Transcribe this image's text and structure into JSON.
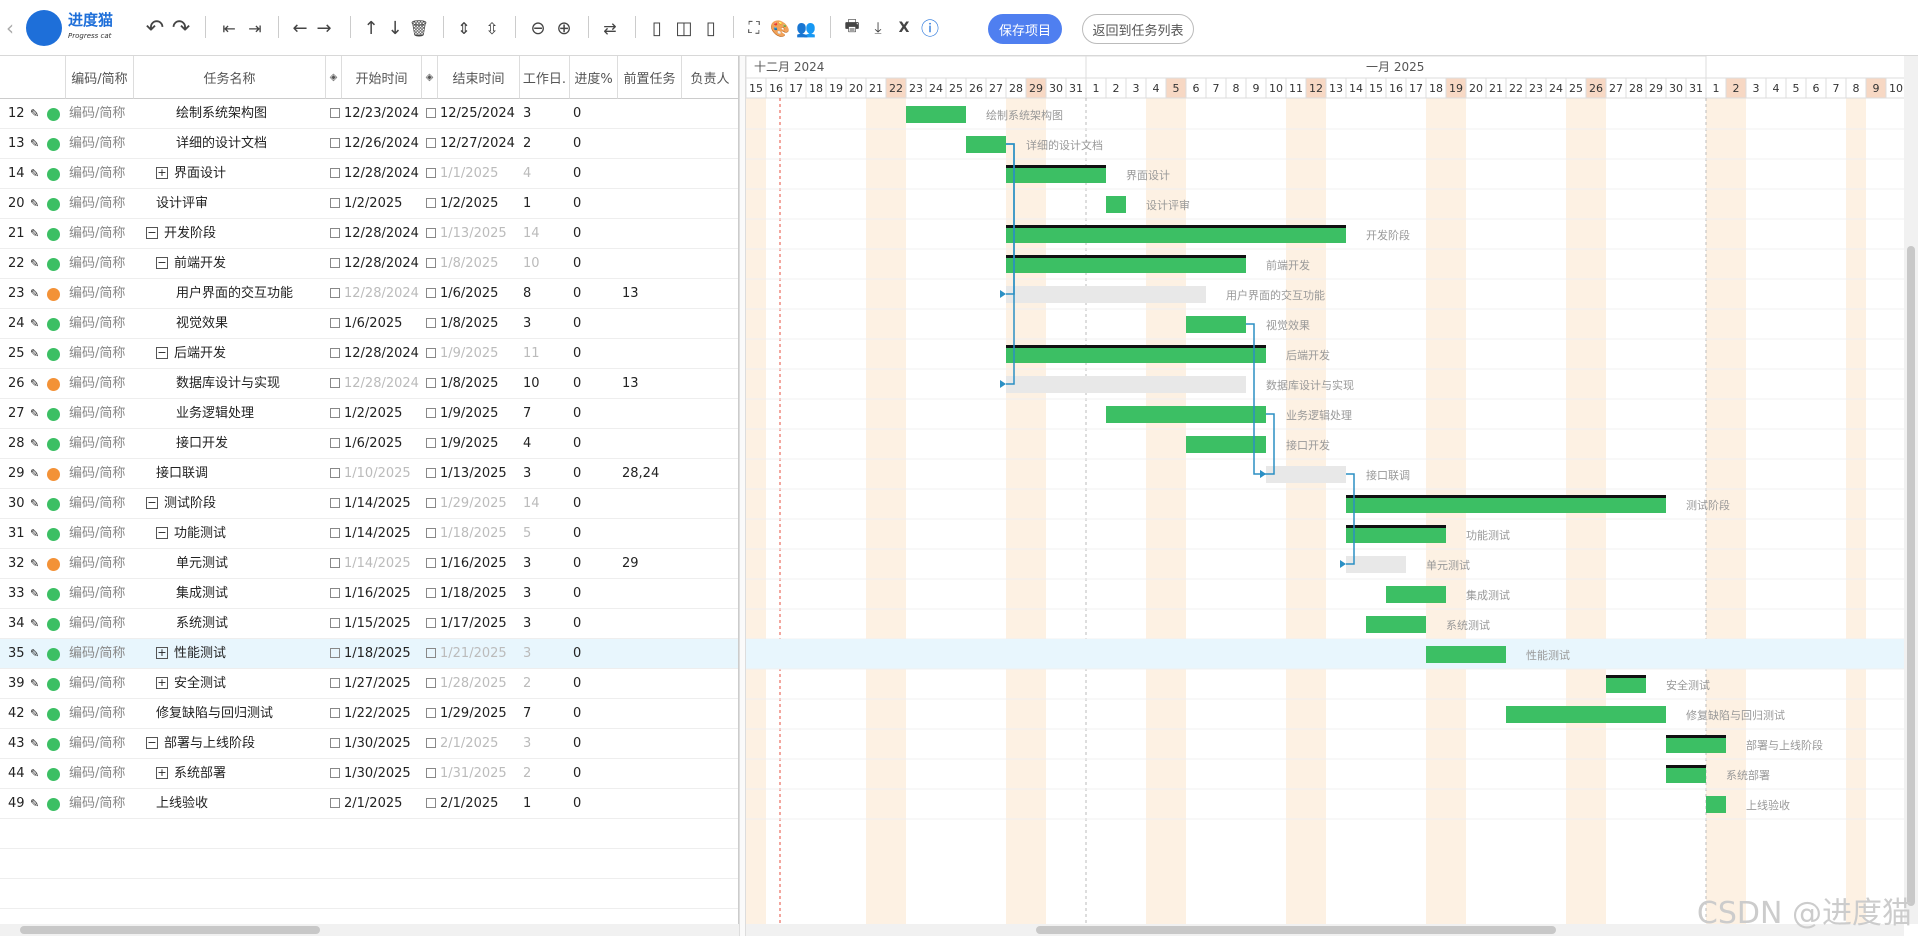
{
  "app": {
    "brand": "进度猫",
    "brand_sub": "Progress cat",
    "save_label": "保存项目",
    "back_label": "返回到任务列表"
  },
  "toolbar_icons": [
    "back-chevron-icon",
    "undo-icon",
    "redo-icon",
    "outdent-icon",
    "indent-icon",
    "arrow-left-icon",
    "arrow-right-icon",
    "arrow-up-icon",
    "arrow-down-icon",
    "trash-icon",
    "expand-rows-icon",
    "collapse-rows-icon",
    "zoom-out-icon",
    "zoom-in-icon",
    "link-tasks-icon",
    "layout-left-icon",
    "layout-split-icon",
    "layout-right-icon",
    "fullscreen-icon",
    "palette-icon",
    "users-icon",
    "print-icon",
    "download-icon",
    "excel-icon",
    "help-icon"
  ],
  "columns": {
    "code": "编码/简称",
    "name": "任务名称",
    "start": "开始时间",
    "end": "结束时间",
    "days": "工作日.",
    "progress": "进度%",
    "pred": "前置任务",
    "owner": "负责人"
  },
  "timeline": {
    "month1": "十二月 2024",
    "month2": "一月 2025",
    "days": [
      "15",
      "16",
      "17",
      "18",
      "19",
      "20",
      "21",
      "22",
      "23",
      "24",
      "25",
      "26",
      "27",
      "28",
      "29",
      "30",
      "31",
      "1",
      "2",
      "3",
      "4",
      "5",
      "6",
      "7",
      "8",
      "9",
      "10",
      "11",
      "12",
      "13",
      "14",
      "15",
      "16",
      "17",
      "18",
      "19",
      "20",
      "21",
      "22",
      "23",
      "24",
      "25",
      "26",
      "27",
      "28",
      "29",
      "30",
      "31",
      "1",
      "2",
      "3",
      "4",
      "5",
      "6",
      "7",
      "8",
      "9",
      "10"
    ]
  },
  "colors": {
    "green": "#3cbf64",
    "orange": "#f39237",
    "link": "#2b8fc4",
    "weekend": "#fdf1e3",
    "holiday": "#f7d8c4",
    "summary": "#111111",
    "ghost": "#e8e8e8",
    "today": "#e74c3c"
  },
  "tasks": [
    {
      "id": "12",
      "code": "编码/简称",
      "name": "绘制系统架构图",
      "indent": 2,
      "tree": "",
      "start": "12/23/2024",
      "start_dim": false,
      "end": "12/25/2024",
      "end_dim": false,
      "days": "3",
      "progress": "0",
      "pred": "",
      "status": "green",
      "bar_start": 8,
      "bar_len": 3,
      "bar_kind": "task"
    },
    {
      "id": "13",
      "code": "编码/简称",
      "name": "详细的设计文档",
      "indent": 2,
      "tree": "",
      "start": "12/26/2024",
      "start_dim": false,
      "end": "12/27/2024",
      "end_dim": false,
      "days": "2",
      "progress": "0",
      "pred": "",
      "status": "green",
      "bar_start": 11,
      "bar_len": 2,
      "bar_kind": "task"
    },
    {
      "id": "14",
      "code": "编码/简称",
      "name": "界面设计",
      "indent": 1,
      "tree": "+",
      "start": "12/28/2024",
      "start_dim": false,
      "end": "1/1/2025",
      "end_dim": true,
      "days": "4",
      "progress": "0",
      "pred": "",
      "status": "green",
      "bar_start": 13,
      "bar_len": 5,
      "bar_kind": "summary"
    },
    {
      "id": "20",
      "code": "编码/简称",
      "name": "设计评审",
      "indent": 1,
      "tree": "",
      "start": "1/2/2025",
      "start_dim": false,
      "end": "1/2/2025",
      "end_dim": false,
      "days": "1",
      "progress": "0",
      "pred": "",
      "status": "green",
      "bar_start": 18,
      "bar_len": 1,
      "bar_kind": "task"
    },
    {
      "id": "21",
      "code": "编码/简称",
      "name": "开发阶段",
      "indent": 0,
      "tree": "-",
      "start": "12/28/2024",
      "start_dim": false,
      "end": "1/13/2025",
      "end_dim": true,
      "days": "14",
      "progress": "0",
      "pred": "",
      "status": "green",
      "bar_start": 13,
      "bar_len": 17,
      "bar_kind": "summary"
    },
    {
      "id": "22",
      "code": "编码/简称",
      "name": "前端开发",
      "indent": 1,
      "tree": "-",
      "start": "12/28/2024",
      "start_dim": false,
      "end": "1/8/2025",
      "end_dim": true,
      "days": "10",
      "progress": "0",
      "pred": "",
      "status": "green",
      "bar_start": 13,
      "bar_len": 12,
      "bar_kind": "summary"
    },
    {
      "id": "23",
      "code": "编码/简称",
      "name": "用户界面的交互功能",
      "indent": 2,
      "tree": "",
      "start": "12/28/2024",
      "start_dim": true,
      "end": "1/6/2025",
      "end_dim": false,
      "days": "8",
      "progress": "0",
      "pred": "13",
      "status": "orange",
      "bar_start": 13,
      "bar_len": 10,
      "bar_kind": "ghost"
    },
    {
      "id": "24",
      "code": "编码/简称",
      "name": "视觉效果",
      "indent": 2,
      "tree": "",
      "start": "1/6/2025",
      "start_dim": false,
      "end": "1/8/2025",
      "end_dim": false,
      "days": "3",
      "progress": "0",
      "pred": "",
      "status": "green",
      "bar_start": 22,
      "bar_len": 3,
      "bar_kind": "task"
    },
    {
      "id": "25",
      "code": "编码/简称",
      "name": "后端开发",
      "indent": 1,
      "tree": "-",
      "start": "12/28/2024",
      "start_dim": false,
      "end": "1/9/2025",
      "end_dim": true,
      "days": "11",
      "progress": "0",
      "pred": "",
      "status": "green",
      "bar_start": 13,
      "bar_len": 13,
      "bar_kind": "summary"
    },
    {
      "id": "26",
      "code": "编码/简称",
      "name": "数据库设计与实现",
      "indent": 2,
      "tree": "",
      "start": "12/28/2024",
      "start_dim": true,
      "end": "1/8/2025",
      "end_dim": false,
      "days": "10",
      "progress": "0",
      "pred": "13",
      "status": "orange",
      "bar_start": 13,
      "bar_len": 12,
      "bar_kind": "ghost"
    },
    {
      "id": "27",
      "code": "编码/简称",
      "name": "业务逻辑处理",
      "indent": 2,
      "tree": "",
      "start": "1/2/2025",
      "start_dim": false,
      "end": "1/9/2025",
      "end_dim": false,
      "days": "7",
      "progress": "0",
      "pred": "",
      "status": "green",
      "bar_start": 18,
      "bar_len": 8,
      "bar_kind": "task"
    },
    {
      "id": "28",
      "code": "编码/简称",
      "name": "接口开发",
      "indent": 2,
      "tree": "",
      "start": "1/6/2025",
      "start_dim": false,
      "end": "1/9/2025",
      "end_dim": false,
      "days": "4",
      "progress": "0",
      "pred": "",
      "status": "green",
      "bar_start": 22,
      "bar_len": 4,
      "bar_kind": "task"
    },
    {
      "id": "29",
      "code": "编码/简称",
      "name": "接口联调",
      "indent": 1,
      "tree": "",
      "start": "1/10/2025",
      "start_dim": true,
      "end": "1/13/2025",
      "end_dim": false,
      "days": "3",
      "progress": "0",
      "pred": "28,24",
      "status": "orange",
      "bar_start": 26,
      "bar_len": 4,
      "bar_kind": "ghost"
    },
    {
      "id": "30",
      "code": "编码/简称",
      "name": "测试阶段",
      "indent": 0,
      "tree": "-",
      "start": "1/14/2025",
      "start_dim": false,
      "end": "1/29/2025",
      "end_dim": true,
      "days": "14",
      "progress": "0",
      "pred": "",
      "status": "green",
      "bar_start": 30,
      "bar_len": 16,
      "bar_kind": "summary"
    },
    {
      "id": "31",
      "code": "编码/简称",
      "name": "功能测试",
      "indent": 1,
      "tree": "-",
      "start": "1/14/2025",
      "start_dim": false,
      "end": "1/18/2025",
      "end_dim": true,
      "days": "5",
      "progress": "0",
      "pred": "",
      "status": "green",
      "bar_start": 30,
      "bar_len": 5,
      "bar_kind": "summary"
    },
    {
      "id": "32",
      "code": "编码/简称",
      "name": "单元测试",
      "indent": 2,
      "tree": "",
      "start": "1/14/2025",
      "start_dim": true,
      "end": "1/16/2025",
      "end_dim": false,
      "days": "3",
      "progress": "0",
      "pred": "29",
      "status": "orange",
      "bar_start": 30,
      "bar_len": 3,
      "bar_kind": "ghost"
    },
    {
      "id": "33",
      "code": "编码/简称",
      "name": "集成测试",
      "indent": 2,
      "tree": "",
      "start": "1/16/2025",
      "start_dim": false,
      "end": "1/18/2025",
      "end_dim": false,
      "days": "3",
      "progress": "0",
      "pred": "",
      "status": "green",
      "bar_start": 32,
      "bar_len": 3,
      "bar_kind": "task"
    },
    {
      "id": "34",
      "code": "编码/简称",
      "name": "系统测试",
      "indent": 2,
      "tree": "",
      "start": "1/15/2025",
      "start_dim": false,
      "end": "1/17/2025",
      "end_dim": false,
      "days": "3",
      "progress": "0",
      "pred": "",
      "status": "green",
      "bar_start": 31,
      "bar_len": 3,
      "bar_kind": "task"
    },
    {
      "id": "35",
      "code": "编码/简称",
      "name": "性能测试",
      "indent": 1,
      "tree": "+",
      "start": "1/18/2025",
      "start_dim": false,
      "end": "1/21/2025",
      "end_dim": true,
      "days": "3",
      "progress": "0",
      "pred": "",
      "status": "green",
      "bar_start": 34,
      "bar_len": 4,
      "bar_kind": "task",
      "selected": true
    },
    {
      "id": "39",
      "code": "编码/简称",
      "name": "安全测试",
      "indent": 1,
      "tree": "+",
      "start": "1/27/2025",
      "start_dim": false,
      "end": "1/28/2025",
      "end_dim": true,
      "days": "2",
      "progress": "0",
      "pred": "",
      "status": "green",
      "bar_start": 43,
      "bar_len": 2,
      "bar_kind": "summary"
    },
    {
      "id": "42",
      "code": "编码/简称",
      "name": "修复缺陷与回归测试",
      "indent": 1,
      "tree": "",
      "start": "1/22/2025",
      "start_dim": false,
      "end": "1/29/2025",
      "end_dim": false,
      "days": "7",
      "progress": "0",
      "pred": "",
      "status": "green",
      "bar_start": 38,
      "bar_len": 8,
      "bar_kind": "task"
    },
    {
      "id": "43",
      "code": "编码/简称",
      "name": "部署与上线阶段",
      "indent": 0,
      "tree": "-",
      "start": "1/30/2025",
      "start_dim": false,
      "end": "2/1/2025",
      "end_dim": true,
      "days": "3",
      "progress": "0",
      "pred": "",
      "status": "green",
      "bar_start": 46,
      "bar_len": 3,
      "bar_kind": "summary"
    },
    {
      "id": "44",
      "code": "编码/简称",
      "name": "系统部署",
      "indent": 1,
      "tree": "+",
      "start": "1/30/2025",
      "start_dim": false,
      "end": "1/31/2025",
      "end_dim": true,
      "days": "2",
      "progress": "0",
      "pred": "",
      "status": "green",
      "bar_start": 46,
      "bar_len": 2,
      "bar_kind": "summary"
    },
    {
      "id": "49",
      "code": "编码/简称",
      "name": "上线验收",
      "indent": 1,
      "tree": "",
      "start": "2/1/2025",
      "start_dim": false,
      "end": "2/1/2025",
      "end_dim": false,
      "days": "1",
      "progress": "0",
      "pred": "",
      "status": "green",
      "bar_start": 48,
      "bar_len": 1,
      "bar_kind": "task"
    }
  ],
  "watermark": "CSDN @进度猫"
}
